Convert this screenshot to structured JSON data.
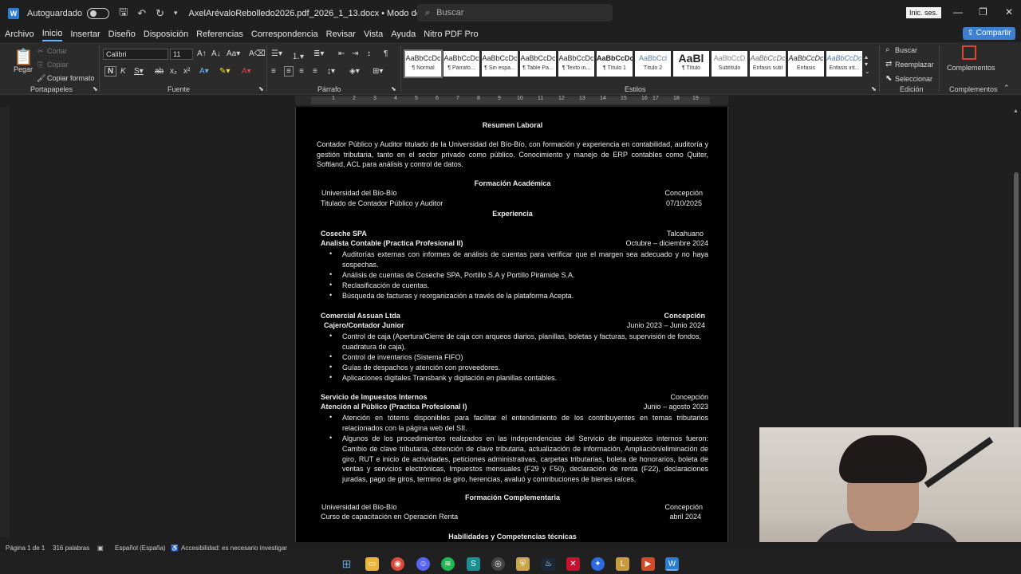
{
  "titlebar": {
    "autosave_label": "Autoguardado",
    "filename": "AxelArévaloRebolledo2026.pdf_2026_1_13.docx  •  Modo de compatibilidad ⌄",
    "search_placeholder": "Buscar",
    "signin_label": "Inic. ses."
  },
  "menu": {
    "items": [
      "Archivo",
      "Inicio",
      "Insertar",
      "Diseño",
      "Disposición",
      "Referencias",
      "Correspondencia",
      "Revisar",
      "Vista",
      "Ayuda",
      "Nitro PDF Pro"
    ],
    "active": "Inicio",
    "share_label": "Compartir"
  },
  "ribbon": {
    "clipboard": {
      "paste": "Pegar",
      "cut": "Cortar",
      "copy": "Copiar",
      "format_painter": "Copiar formato",
      "label": "Portapapeles"
    },
    "font": {
      "name": "Calibri",
      "size": "11",
      "label": "Fuente"
    },
    "paragraph": {
      "label": "Párrafo"
    },
    "styles": {
      "label": "Estilos",
      "items": [
        {
          "sample": "AaBbCcDc",
          "name": "¶ Normal"
        },
        {
          "sample": "AaBbCcDc",
          "name": "¶ Párrafo..."
        },
        {
          "sample": "AaBbCcDc",
          "name": "¶ Sin espa..."
        },
        {
          "sample": "AaBbCcDc",
          "name": "¶ Table Pa..."
        },
        {
          "sample": "AaBbCcDc",
          "name": "¶ Texto in..."
        },
        {
          "sample": "AaBbCcDc",
          "name": "¶ Título 1"
        },
        {
          "sample": "AaBbCcl",
          "name": "Título 2"
        },
        {
          "sample": "AaBl",
          "name": "¶ Título"
        },
        {
          "sample": "AaBbCcD",
          "name": "Subtítulo"
        },
        {
          "sample": "AaBbCcDc",
          "name": "Énfasis sutil"
        },
        {
          "sample": "AaBbCcDc",
          "name": "Énfasis"
        },
        {
          "sample": "AaBbCcDc",
          "name": "Énfasis int..."
        }
      ]
    },
    "editing": {
      "find": "Buscar",
      "replace": "Reemplazar",
      "select": "Seleccionar",
      "label": "Edición"
    },
    "addins": {
      "label": "Complementos",
      "button": "Complementos"
    }
  },
  "ruler": {
    "numbers": [
      "1",
      "2",
      "3",
      "4",
      "5",
      "6",
      "7",
      "8",
      "9",
      "10",
      "11",
      "12",
      "13",
      "14",
      "15",
      "16",
      "17",
      "18",
      "19"
    ]
  },
  "document": {
    "summary_heading": "Resumen Laboral",
    "summary_text": "Contador Público y Auditor titulado de la Universidad del Bío-Bío, con formación y experiencia en contabilidad, auditoría y gestión tributaria, tanto en el sector privado como público. Conocimiento y manejo de ERP contables como Quiter, Softland, ACL para análisis y control de datos.",
    "education_heading": "Formación Académica",
    "edu_left1": "Universidad del Bío-Bío",
    "edu_right1": "Concepción",
    "edu_left2": "Titulado de Contador Público y Auditor",
    "edu_right2": "07/10/2025",
    "experience_heading": "Experiencia",
    "job1": {
      "company": "Coseche SPA",
      "location": "Talcahuano",
      "role": "Analista Contable (Practica Profesional II)",
      "dates": "Octubre – diciembre 2024",
      "bullets": [
        "Auditorías externas con informes de análisis de cuentas para verificar que el margen sea adecuado y no haya sospechas.",
        "Análisis de cuentas de Coseche SPA, Portillo S.A y Portillo Pirámide S.A.",
        "Reclasificación  de cuentas.",
        "Búsqueda de facturas y reorganización  a través de la plataforma  Acepta."
      ]
    },
    "job2": {
      "company": "Comercial Assuan Ltda",
      "location": "Concepción",
      "role": "Cajero/Contador Junior",
      "dates": "Junio 2023 – Junio 2024",
      "bullets": [
        "Control de caja (Apertura/Cierre de caja con arqueos diarios, planillas, boletas y facturas, supervisión de fondos, cuadratura de caja).",
        "Control de inventarios (Sistema FIFO)",
        "Guías de despachos y atención con proveedores.",
        "Aplicaciones digitales Transbank y digitación en planillas contables."
      ]
    },
    "job3": {
      "company": "Servicio de Impuestos Internos",
      "location": "Concepción",
      "role": "Atención al Público (Practica Profesional I)",
      "dates": "Junio – agosto 2023",
      "bullets": [
        "Atención en tótems disponibles para facilitar el entendimiento de los contribuyentes en temas tributarios relacionados  con la página web del SII.",
        "Algunos de los procedimientos realizados en las independencias del Servicio de impuestos internos fueron: Cambio de clave tributaria, obtención de clave tributaria, actualización de información, Ampliación/eliminación de giro, RUT e inicio de actividades, peticiones administrativas, carpetas tributarias, boleta de honorarios, boleta de ventas y servicios electrónicas, Impuestos mensuales (F29 y F50), declaración de renta (F22), declaraciones juradas, pago de giros, termino de giro, herencias, avaluó y contribuciones de bienes raíces."
      ]
    },
    "complementary_heading": "Formación Complementaria",
    "comp_left1": "Universidad del Bío-Bío",
    "comp_right1": "Concepción",
    "comp_left2": "Curso de capacitación en Operación Renta",
    "comp_right2": "abril 2024",
    "skills_heading": "Habilidades y Competencias técnicas"
  },
  "statusbar": {
    "page": "Página 1 de 1",
    "words": "316 palabras",
    "language": "Español (España)",
    "accessibility": "Accesibilidad: es necesario investigar"
  },
  "colors": {
    "accent": "#3e7fcf",
    "ribbon_bg": "#2b2b2b",
    "page_bg": "#000000",
    "word_blue": "#2b7cd3"
  }
}
